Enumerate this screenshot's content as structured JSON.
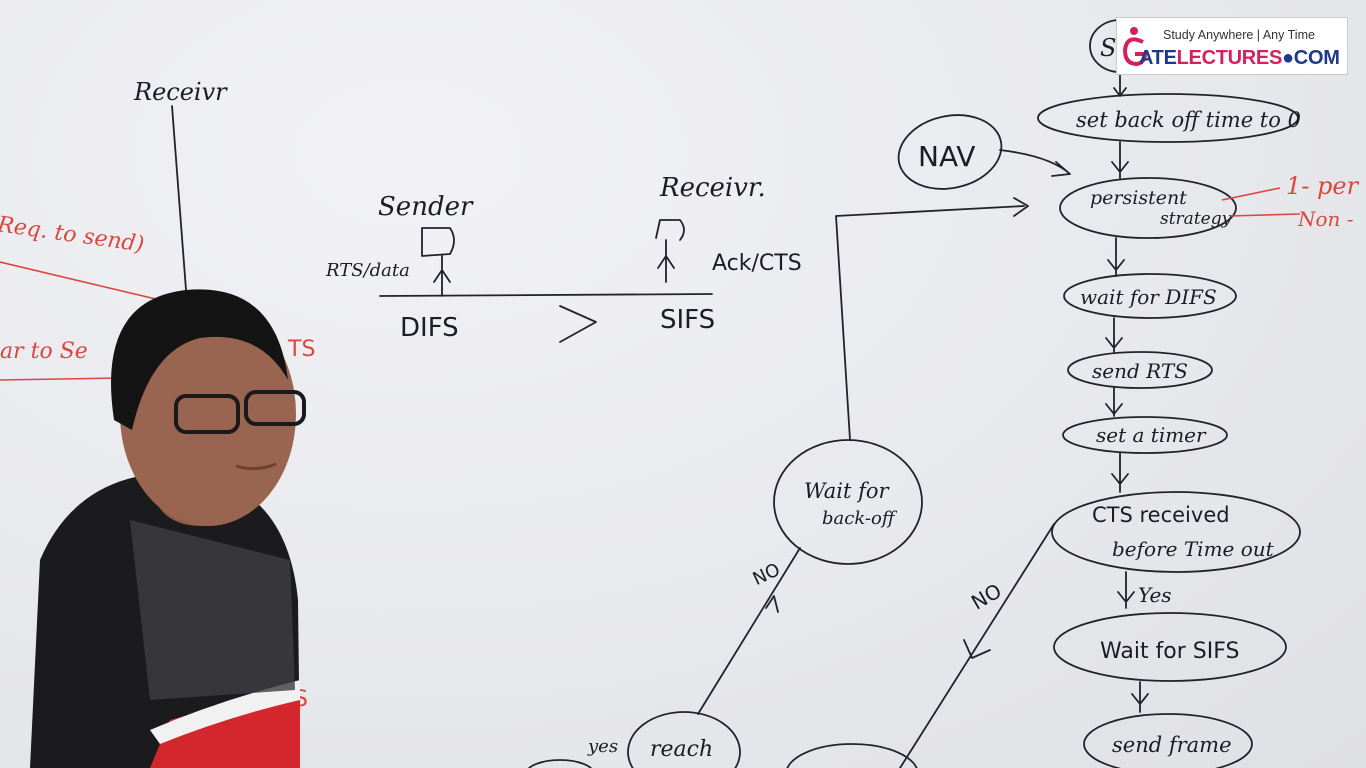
{
  "board": {
    "left": {
      "receiver_label": "Receivr",
      "req_to_send": "Req. to send)",
      "clear_to_send": "ar to Se",
      "cts_fragment": "TS",
      "s_fragment": "S"
    },
    "middle": {
      "sender_label": "Sender",
      "receiver_label": "Receivr.",
      "rts_data": "RTS/data",
      "ack_cts": "Ack/CTS",
      "difs": "DIFS",
      "gt": ">",
      "sifs": "SIFS"
    },
    "flowchart": {
      "start_fragment": "S",
      "set_backoff": "set back off time to 0",
      "nav": "NAV",
      "persistent_line1": "persistent",
      "persistent_line2": "strategy",
      "one_persistent": "1- per",
      "non_persistent": "Non -",
      "wait_difs": "wait for DIFS",
      "send_rts": "send RTS",
      "set_timer": "set a timer",
      "cts_line1": "CTS received",
      "cts_line2": "before Time out",
      "yes_label": "Yes",
      "wait_sifs": "Wait for SIFS",
      "send_frame": "send frame",
      "no_label_right": "NO",
      "wait_backoff_line1": "Wait for",
      "wait_backoff_line2": "back-off",
      "no_label_left": "NO",
      "reach_fragment": "reach",
      "yes_bottom": "yes"
    }
  },
  "logo": {
    "tagline": "Study Anywhere | Any Time",
    "word_part1": "ATE",
    "word_part2": "LECTURES",
    "word_part3": "COM"
  },
  "colors": {
    "board": "#e9eaee",
    "ink": "#22222a",
    "red_marker": "#d9473e",
    "logo_blue": "#1f3a8a",
    "logo_pink": "#d61f5d"
  }
}
